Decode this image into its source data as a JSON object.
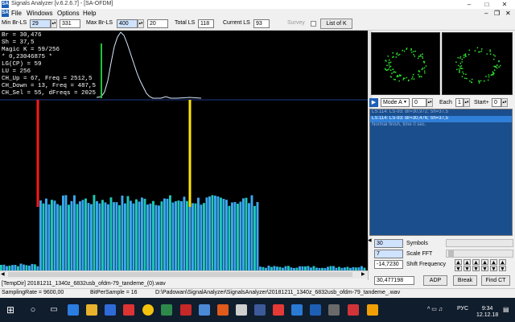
{
  "window": {
    "title": "Signals Analyzer [v.6.2.6.7] - [SA-OFDM]"
  },
  "menu": [
    "File",
    "Windows",
    "Options",
    "Help"
  ],
  "toolbar": {
    "min_br_ls_label": "Min Br-LS",
    "min_br_ls_value": "29",
    "min_br_ls_value2": "331",
    "max_br_ls_label": "Max Br-LS",
    "max_br_ls_value": "400",
    "max_br_ls_value2": "20",
    "total_ls_label": "Total LS",
    "total_ls_value": "118",
    "current_ls_label": "Current LS",
    "current_ls_value": "93",
    "survey_label": "Survey",
    "list_of_k_label": "List of K"
  },
  "plot_info": [
    "Br = 30,476",
    "Sh = 37,5",
    "Magic K = 59/256",
    "* 0,23046875 *",
    "LG(CP) = 59",
    "LU = 256",
    "CH_Up = 67, Freq = 2512,5",
    "CH_Down = 13, Freq = 487,5",
    "CH_Sel = 55, dFreqs = 2025"
  ],
  "right_panel": {
    "mode_label": "Mode A",
    "mode_value": "0",
    "each_label": "Each",
    "each_value": "1",
    "start_label": "Start+",
    "start_value": "0",
    "log_lines": [
      "LS:114: LS-93: Br=30,972; Sh=37,5",
      "LS:114: LS-93: Br=30,476; Sh=37,5",
      "Normal finish, time 0 sec."
    ],
    "symbols_value": "30",
    "symbols_label": "Symbols",
    "scale_fft_value": "7",
    "scale_fft_label": "Scale FFT",
    "shift_freq_value": "-14,7230",
    "shift_freq_label": "Shift Frequency",
    "br_value": "30,477198",
    "adp_label": "ADP",
    "break_label": "Break",
    "find_ct_label": "Find CT"
  },
  "status": {
    "path": "[TempDir] 20181211_1340z_6832usb_ofdm-79_tandeme_(0).wav",
    "sampling_rate": "SamplingRate = 9600,00",
    "bits_per_sample": "BitPerSample = 16",
    "full_path": "D:\\Padowan\\SignalAnalyzer\\SignalsAnalyzer\\20181211_1340z_6832usb_ofdm-79_tandeme_.wav"
  },
  "taskbar": {
    "tray_lang": "РУС",
    "time": "9:34",
    "date": "12.12.18"
  },
  "colors": {
    "spectrum_bar": "#3ba8f0",
    "spectrum_bar_alt": "#1ec8b8",
    "red_marker": "#ff1a1a",
    "yellow_marker": "#ffe400",
    "green_marker": "#22c33a",
    "curve": "#d8e8ff",
    "constellation": "#2ddb2d"
  }
}
